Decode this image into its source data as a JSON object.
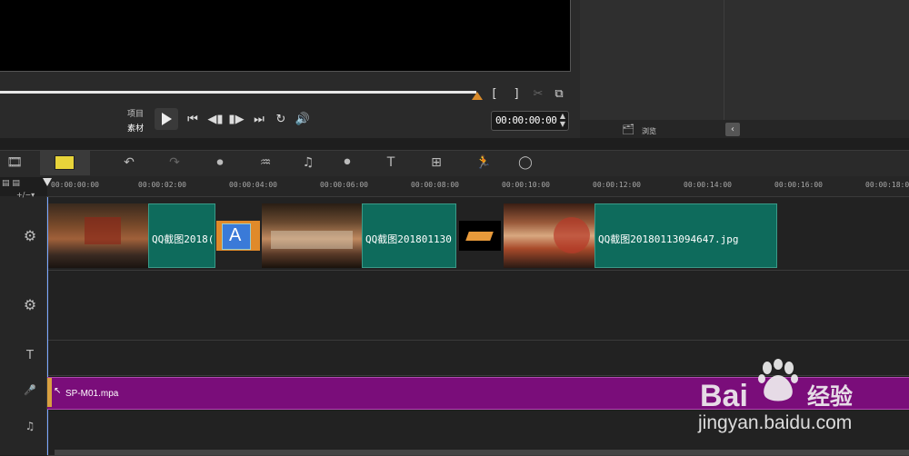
{
  "preview": {
    "label_project": "项目",
    "label_clip": "素材",
    "timecode": "00:00:00:00",
    "mark_in": "[",
    "mark_out": "]"
  },
  "library": {
    "browse_label": "浏览"
  },
  "ruler": {
    "ticks": [
      "00:00:00:00",
      "00:00:02:00",
      "00:00:04:00",
      "00:00:06:00",
      "00:00:08:00",
      "00:00:10:00",
      "00:00:12:00",
      "00:00:14:00",
      "00:00:16:00",
      "00:00:18:00"
    ]
  },
  "video_track": {
    "clip1_title": "QQ截图2018(",
    "clip2_title": "QQ截图201801130",
    "clip3_title": "QQ截图20180113094647.jpg",
    "transition_letter": "A"
  },
  "music_track": {
    "clip_name": "SP-M01.mpa"
  },
  "watermark": {
    "brand": "Bai du 经验",
    "url": "jingyan.baidu.com"
  },
  "colors": {
    "clip_green": "#0e6b5c",
    "audio_purple": "#7a0d7a",
    "scrub_orange": "#d88a2a"
  }
}
